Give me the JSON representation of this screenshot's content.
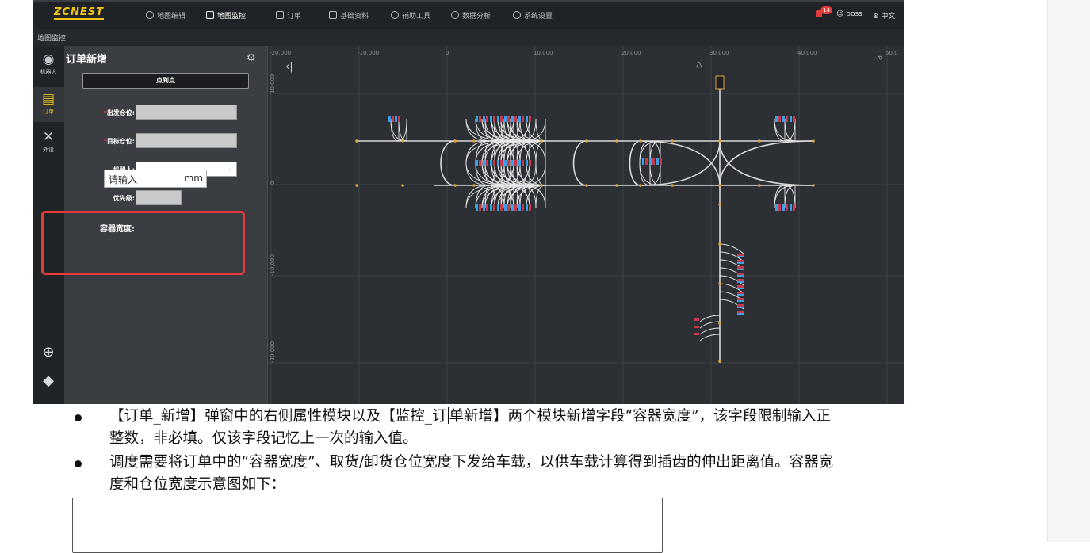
{
  "app": {
    "logo": "ZCNEST",
    "nav": [
      {
        "label": "地图编辑",
        "active": false
      },
      {
        "label": "地图监控",
        "active": true
      },
      {
        "label": "订单",
        "active": false
      },
      {
        "label": "基础资料",
        "active": false
      },
      {
        "label": "辅助工具",
        "active": false
      },
      {
        "label": "数据分析",
        "active": false
      },
      {
        "label": "系统设置",
        "active": false
      }
    ],
    "notification_count": "14",
    "user": "boss",
    "language": "中文",
    "breadcrumb": "地图监控",
    "rail": [
      {
        "label": "机器人",
        "icon": "robot-icon"
      },
      {
        "label": "订单",
        "icon": "clipboard-icon",
        "active": true
      },
      {
        "label": "外设",
        "icon": "tools-icon"
      }
    ],
    "panel": {
      "title": "订单新增",
      "mode_button": "点到点",
      "fields": {
        "start": {
          "label": "出发仓位:",
          "prefix": "*"
        },
        "target": {
          "label": "目标仓位:",
          "prefix": "*"
        },
        "robot": {
          "label": "机器人:"
        },
        "priority": {
          "label": "优先级:"
        },
        "container_width": {
          "label": "容器宽度:",
          "placeholder": "请输入",
          "unit": "mm"
        }
      }
    },
    "map": {
      "x_ticks": [
        "-20,000",
        "-10,000",
        "0",
        "10,000",
        "20,000",
        "30,000",
        "40,000",
        "50,0"
      ],
      "y_ticks": [
        "10,000",
        "0",
        "-10,000",
        "-20,000"
      ],
      "colors": {
        "road": "#d8d8d8",
        "node": "#e0a23a",
        "rack_blue": "#3aa0e8",
        "rack_red": "#c83a4a"
      }
    }
  },
  "document": {
    "bullets": [
      {
        "before_caret": "【订单_新增】弹窗中的右侧属性模块以及【监控_订",
        "after_caret": "单新增】两个模块新增字段“容器宽度”，该字段限制输入正",
        "line2": "整数，非必填。仅该字段记忆上一次的输入值。"
      },
      {
        "line1": "调度需要将订单中的“容器宽度”、取货/卸货仓位宽度下发给车载，以供车载计算得到插齿的伸出距离值。容器宽",
        "line2": "度和仓位宽度示意图如下："
      }
    ]
  }
}
